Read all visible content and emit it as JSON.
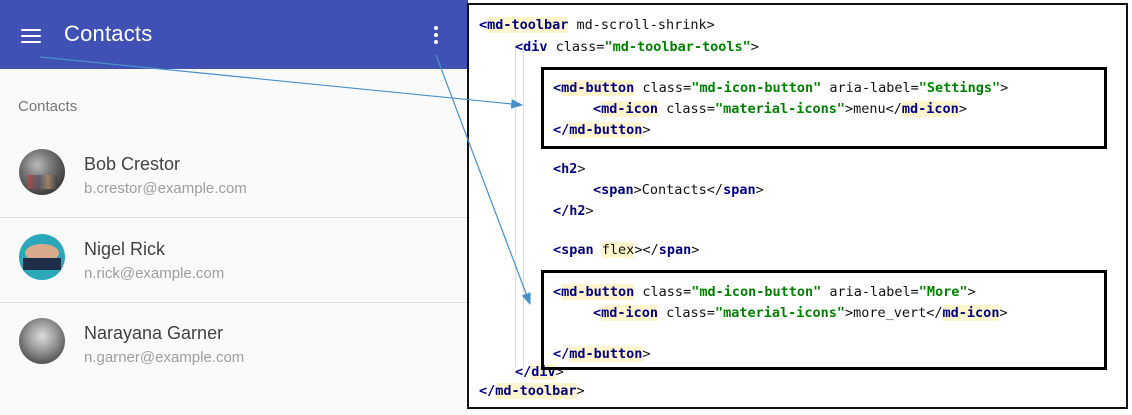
{
  "toolbar": {
    "title": "Contacts",
    "menu_icon": "menu-icon",
    "more_icon": "more-vert-icon",
    "color": "#3f51b5"
  },
  "subheader": "Contacts",
  "contacts": [
    {
      "name": "Bob Crestor",
      "email": "b.crestor@example.com"
    },
    {
      "name": "Nigel Rick",
      "email": "n.rick@example.com"
    },
    {
      "name": "Narayana Garner",
      "email": "n.garner@example.com"
    }
  ],
  "code": {
    "l1": {
      "open": "<",
      "tag": "md-toolbar",
      "rest": " md-scroll-shrink>"
    },
    "l2": {
      "open": "<",
      "tag": "div",
      "attr": " class=",
      "val": "\"md-toolbar-tools\"",
      "close": ">"
    },
    "l3": {
      "open": "<",
      "tag": "md-button",
      "attr": " class=",
      "val": "\"md-icon-button\"",
      "attr2": " aria-label=",
      "val2": "\"Settings\"",
      "close": ">"
    },
    "l4": {
      "open": "<",
      "tag": "md-icon",
      "attr": " class=",
      "val": "\"material-icons\"",
      "text": ">menu</",
      "tag2": "md-icon",
      "close": ">"
    },
    "l5": {
      "open": "</",
      "tag": "md-button",
      "close": ">"
    },
    "l6": {
      "open": "<",
      "tag": "h2",
      "close": ">"
    },
    "l7": {
      "open": "<",
      "tag": "span",
      "text": ">Contacts</",
      "tag2": "span",
      "close": ">"
    },
    "l8": {
      "open": "</",
      "tag": "h2",
      "close": ">"
    },
    "l9": {
      "open": "<",
      "tag": "span",
      "attr": "flex",
      "text": "></",
      "tag2": "span",
      "close": ">"
    },
    "l10": {
      "open": "<",
      "tag": "md-button",
      "attr": " class=",
      "val": "\"md-icon-button\"",
      "attr2": " aria-label=",
      "val2": "\"More\"",
      "close": ">"
    },
    "l11": {
      "open": "<",
      "tag": "md-icon",
      "attr": " class=",
      "val": "\"material-icons\"",
      "text": ">more_vert</",
      "tag2": "md-icon",
      "close": ">"
    },
    "l12": {
      "open": "</",
      "tag": "md-button",
      "close": ">"
    },
    "l13": {
      "open": "</",
      "tag": "div",
      "close": ">"
    },
    "l14": {
      "open": "</",
      "tag": "md-toolbar",
      "close": ">"
    }
  },
  "colors": {
    "tag": "#000080",
    "value": "#008000",
    "highlight": "#fff5cc",
    "arrow": "#4a90c8"
  }
}
